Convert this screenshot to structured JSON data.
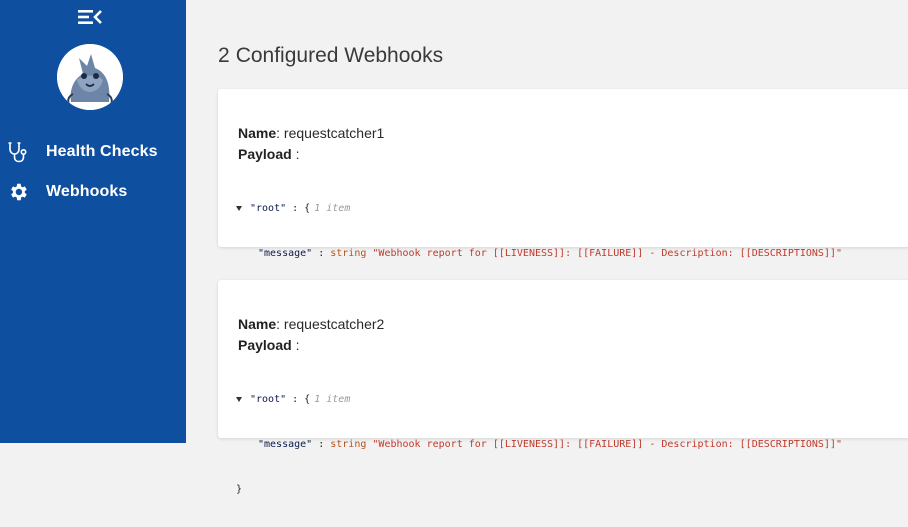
{
  "sidebar": {
    "menu_icon": "menu-collapse-icon",
    "avatar_icon": "mascot-avatar",
    "items": [
      {
        "label": "Health Checks",
        "icon": "stethoscope-icon"
      },
      {
        "label": "Webhooks",
        "icon": "gear-icon"
      }
    ],
    "color": "#0f4fa0"
  },
  "main": {
    "title_count": "2",
    "title_text": "Configured Webhooks",
    "webhooks": [
      {
        "name_label": "Name",
        "name_value": ": requestcatcher1",
        "payload_label": "Payload",
        "payload_colon": " :",
        "json": {
          "root_key": "\"root\"",
          "root_open": " : {",
          "root_count": "1 item",
          "message_key": "\"message\"",
          "sep": " : ",
          "message_type": "string",
          "message_value": "\"Webhook report for [[LIVENESS]]: [[FAILURE]] - Description: [[DESCRIPTIONS]]\"",
          "close": "}"
        }
      },
      {
        "name_label": "Name",
        "name_value": ": requestcatcher2",
        "payload_label": "Payload",
        "payload_colon": " :",
        "json": {
          "root_key": "\"root\"",
          "root_open": " : {",
          "root_count": "1 item",
          "message_key": "\"message\"",
          "sep": " : ",
          "message_type": "string",
          "message_value": "\"Webhook report for [[LIVENESS]]: [[FAILURE]] - Description: [[DESCRIPTIONS]]\"",
          "close": "}"
        }
      }
    ]
  }
}
